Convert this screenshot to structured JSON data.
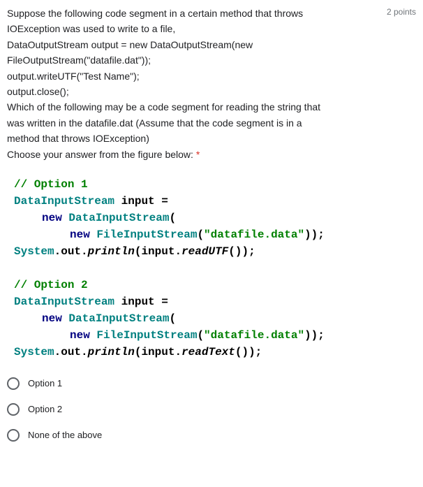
{
  "points_label": "2 points",
  "question": {
    "line1": "Suppose the following code segment in a certain method that throws",
    "line2": "IOException was used to write to a file,",
    "line3": "DataOutputStream output = new DataOutputStream(new",
    "line4": "FileOutputStream(\"datafile.dat\"));",
    "line5": "output.writeUTF(\"Test Name\");",
    "line6": "output.close();",
    "line7": "Which of the following may be a code segment for reading the string that",
    "line8": "was written in the datafile.dat (Assume that the code segment is in a",
    "line9": "method that throws IOException)",
    "line10": "Choose your answer from the figure below: ",
    "required": "*"
  },
  "code": {
    "opt1_comment": "// Option 1",
    "opt2_comment": "// Option 2",
    "dis": "DataInputStream",
    "input_eq": " input =",
    "new_kw": "new ",
    "dis_paren": "DataInputStream",
    "open_paren": "(",
    "fis": "FileInputStream",
    "str_lit": "\"datafile.data\"",
    "close_paren": "));",
    "sys": "System",
    "dot_out_dot": ".out.",
    "println": "println",
    "open_p2": "(input.",
    "readUTF": "readUTF",
    "readText": "readText",
    "close_p2": "());"
  },
  "options": [
    {
      "label": "Option 1"
    },
    {
      "label": "Option 2"
    },
    {
      "label": "None of the above"
    }
  ]
}
